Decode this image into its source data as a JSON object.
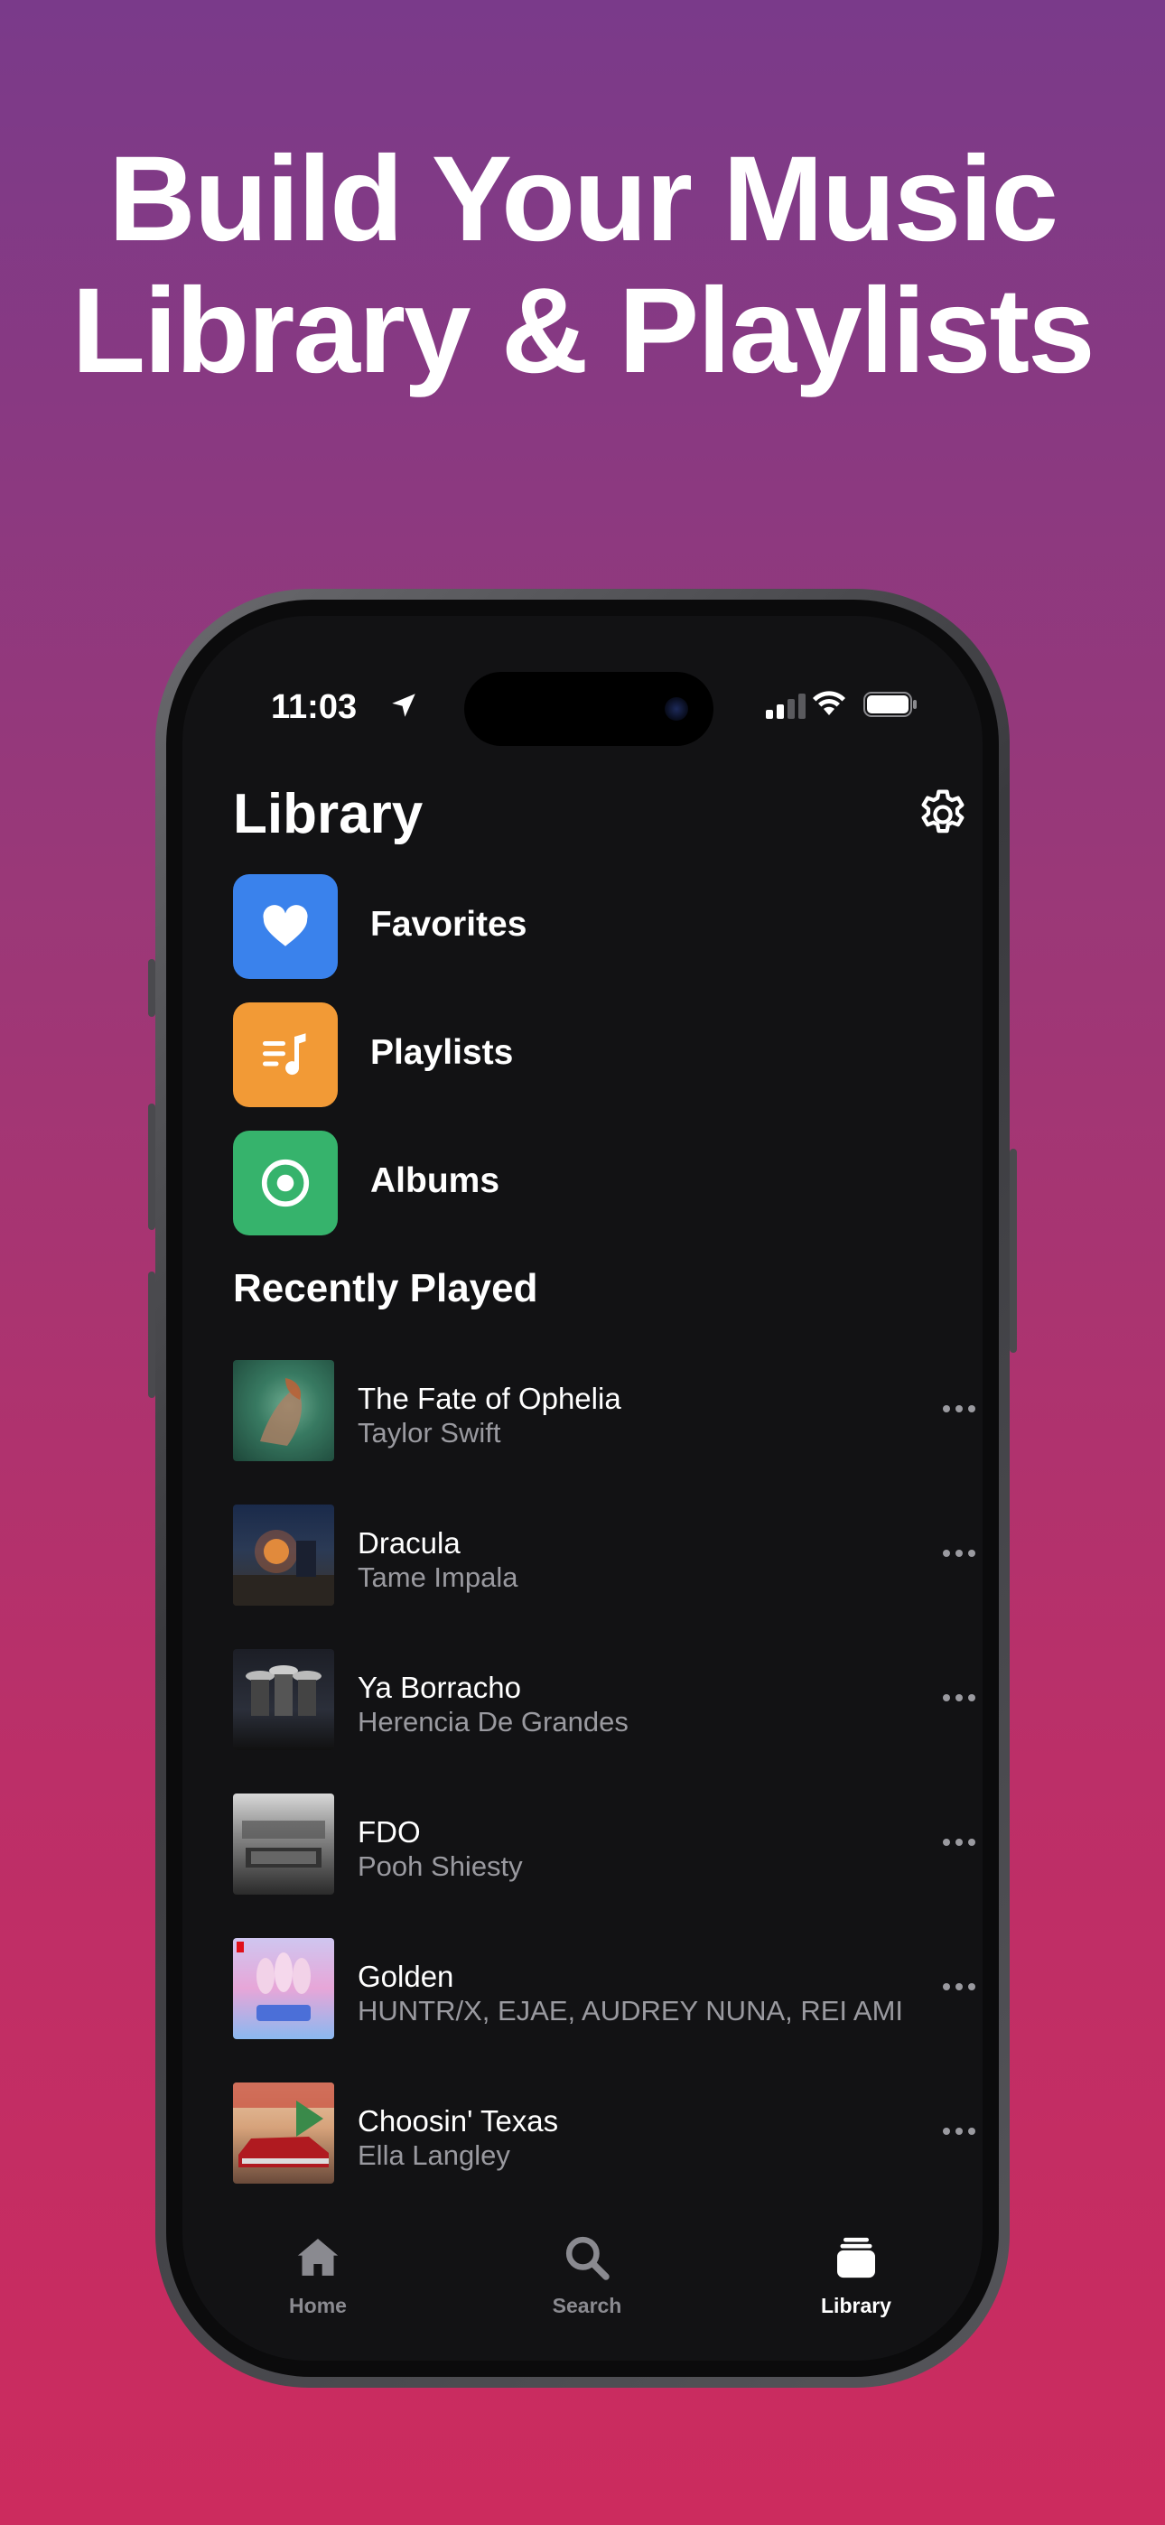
{
  "headline": {
    "line1": "Build Your Music",
    "line2": "Library & Playlists"
  },
  "status_bar": {
    "time": "11:03"
  },
  "library": {
    "title": "Library",
    "categories": [
      {
        "label": "Favorites",
        "icon": "heart-icon",
        "color": "#3a82ec"
      },
      {
        "label": "Playlists",
        "icon": "playlist-icon",
        "color": "#f29a36"
      },
      {
        "label": "Albums",
        "icon": "album-icon",
        "color": "#36b36c"
      }
    ]
  },
  "recently_played": {
    "title": "Recently Played",
    "tracks": [
      {
        "title": "The Fate of Ophelia",
        "artist": "Taylor Swift"
      },
      {
        "title": "Dracula",
        "artist": "Tame Impala"
      },
      {
        "title": "Ya Borracho",
        "artist": "Herencia De Grandes"
      },
      {
        "title": "FDO",
        "artist": "Pooh Shiesty"
      },
      {
        "title": "Golden",
        "artist": "HUNTR/X, EJAE, AUDREY NUNA, REI AMI"
      },
      {
        "title": "Choosin' Texas",
        "artist": "Ella Langley"
      }
    ]
  },
  "tabbar": {
    "tabs": [
      {
        "label": "Home",
        "icon": "home-icon"
      },
      {
        "label": "Search",
        "icon": "search-icon"
      },
      {
        "label": "Library",
        "icon": "library-icon",
        "active": true
      }
    ]
  },
  "colors": {
    "background_top": "#7a3a8a",
    "background_bottom": "#cc2b5e",
    "screen": "#121214"
  }
}
